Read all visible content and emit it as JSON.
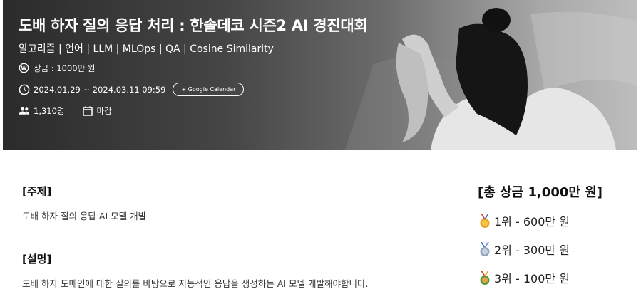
{
  "banner": {
    "title": "도배 하자 질의 응답 처리 : 한솔데코 시즌2 AI 경진대회",
    "tags": "알고리즘 | 언어 | LLM | MLOps | QA | Cosine Similarity",
    "prize_text": "상금 : 1000만 원",
    "period": "2024.01.29 ~ 2024.03.11 09:59",
    "calendar_button": "+ Google Calendar",
    "participants": "1,310명",
    "status": "마감"
  },
  "content": {
    "topic_heading": "[주제]",
    "topic_text": "도배 하자 질의 응답 AI 모델 개발",
    "desc_heading": "[설명]",
    "desc_text": "도배 하자 도메인에 대한 질의를 바탕으로 지능적인 응답을 생성하는 AI 모델 개발해야합니다."
  },
  "prizes": {
    "title": "[총 상금 1,000만 원]",
    "items": [
      {
        "label": "1위 - 600만 원",
        "color": "#e9a324"
      },
      {
        "label": "2위 - 300만 원",
        "color": "#8fa3b8"
      },
      {
        "label": "3위 - 100만 원",
        "color": "#4e9a3a"
      }
    ]
  }
}
